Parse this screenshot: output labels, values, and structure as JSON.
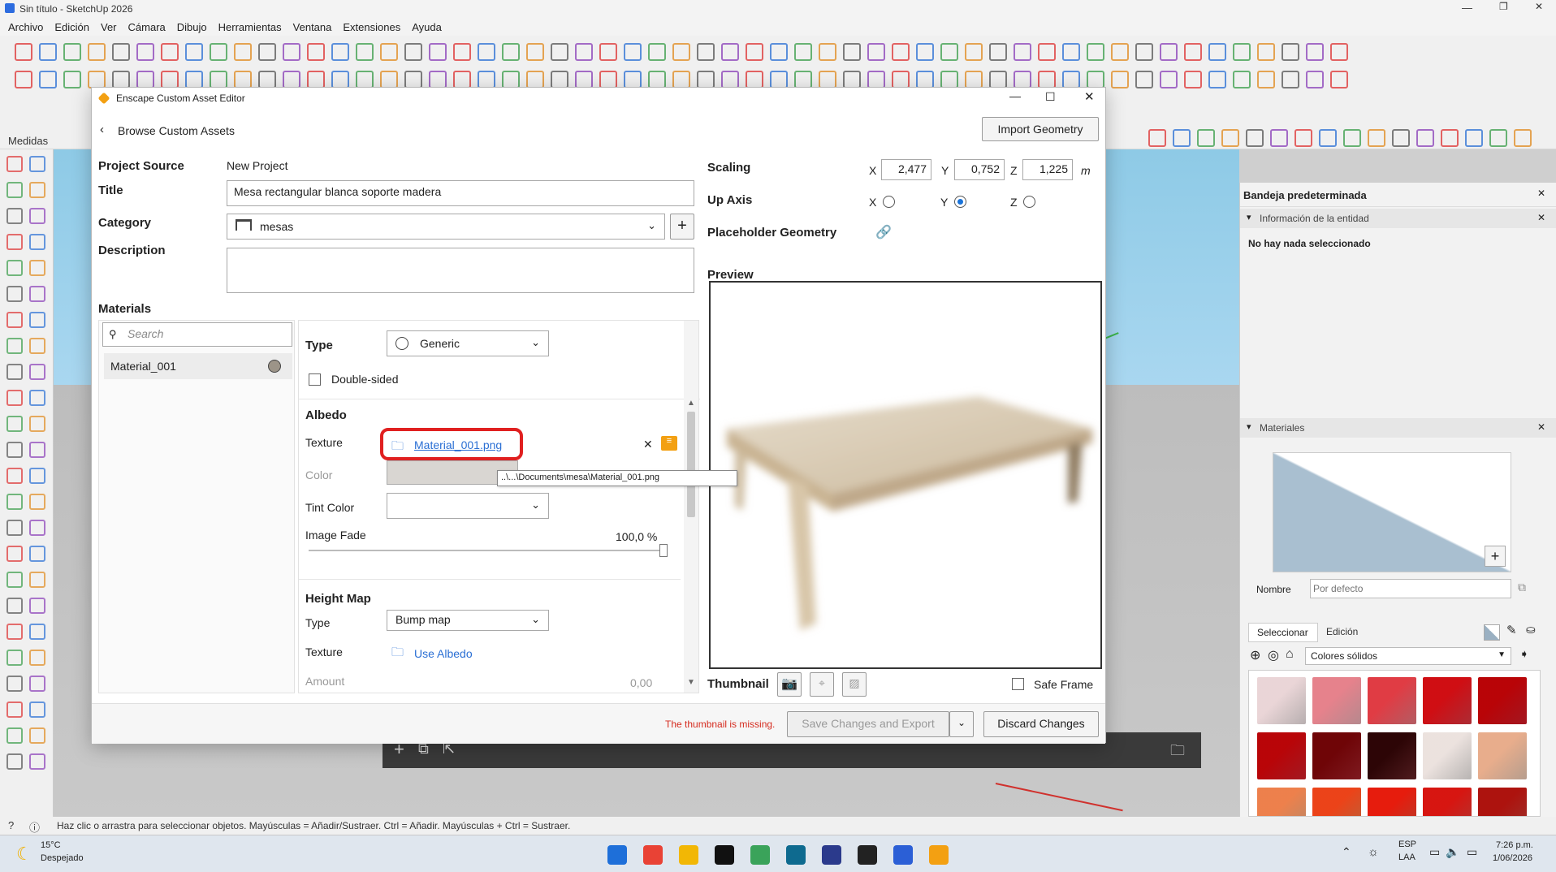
{
  "window": {
    "title": "Sin título - SketchUp 2026"
  },
  "menu": [
    "Archivo",
    "Edición",
    "Ver",
    "Cámara",
    "Dibujo",
    "Herramientas",
    "Ventana",
    "Extensiones",
    "Ayuda"
  ],
  "medidas_label": "Medidas",
  "dialog": {
    "title": "Enscape Custom Asset Editor",
    "back_label": "Browse Custom Assets",
    "import_button": "Import Geometry",
    "project_source_label": "Project Source",
    "project_source_value": "New Project",
    "title_label": "Title",
    "title_value": "Mesa rectangular blanca soporte madera",
    "category_label": "Category",
    "category_value": "mesas",
    "description_label": "Description",
    "description_value": "",
    "materials_label": "Materials",
    "search_placeholder": "Search",
    "material_item": "Material_001",
    "type_label": "Type",
    "type_value": "Generic",
    "double_sided_label": "Double-sided",
    "albedo_label": "Albedo",
    "texture_label": "Texture",
    "texture_file": "Material_001.png",
    "texture_path_tooltip": "..\\...\\Documents\\mesa\\Material_001.png",
    "color_label": "Color",
    "tint_color_label": "Tint Color",
    "image_fade_label": "Image Fade",
    "image_fade_value": "100,0 %",
    "image_fade_fraction": 1.0,
    "height_map_label": "Height Map",
    "height_type_label": "Type",
    "height_type_value": "Bump map",
    "height_texture_label": "Texture",
    "height_texture_value": "Use Albedo",
    "amount_label": "Amount",
    "amount_value": "0,00",
    "scaling_label": "Scaling",
    "scale_x_label": "X",
    "scale_x": "2,477",
    "scale_y_label": "Y",
    "scale_y": "0,752",
    "scale_z_label": "Z",
    "scale_z": "1,225",
    "scale_unit": "m",
    "up_axis_label": "Up Axis",
    "up_axis_options": [
      "X",
      "Y",
      "Z"
    ],
    "up_axis_selected": "Y",
    "placeholder_label": "Placeholder Geometry",
    "preview_label": "Preview",
    "thumbnail_label": "Thumbnail",
    "safe_frame_label": "Safe Frame",
    "thumbnail_missing": "The thumbnail is missing.",
    "save_button": "Save Changes and Export",
    "discard_button": "Discard Changes"
  },
  "right_panel": {
    "tray_title": "Bandeja predeterminada",
    "entity_section": "Información de la entidad",
    "entity_status": "No hay nada seleccionado",
    "materials_section": "Materiales",
    "name_label": "Nombre",
    "name_placeholder": "Por defecto",
    "tab_select": "Seleccionar",
    "tab_edit": "Edición",
    "library": "Colores sólidos",
    "swatch_colors": [
      "#f4e9ea",
      "#f2b6bd",
      "#ef7c84",
      "#e63b46",
      "#d91f2b",
      "#d9222d",
      "#a8232b",
      "#6b2528",
      "#f5f0ee",
      "#f3d2bd",
      "#f6b58b",
      "#f58350",
      "#f2543a",
      "#ea4a42",
      "#d2453c"
    ]
  },
  "status_text": "Haz clic o arrastra para seleccionar objetos. Mayúsculas = Añadir/Sustraer. Ctrl = Añadir. Mayúsculas + Ctrl = Sustraer.",
  "taskbar": {
    "weather_temp": "15°C",
    "weather_text": "Despejado",
    "lang": "ESP",
    "lang2": "LAA",
    "time": "7:26 p.m.",
    "date": "1/06/2026"
  }
}
